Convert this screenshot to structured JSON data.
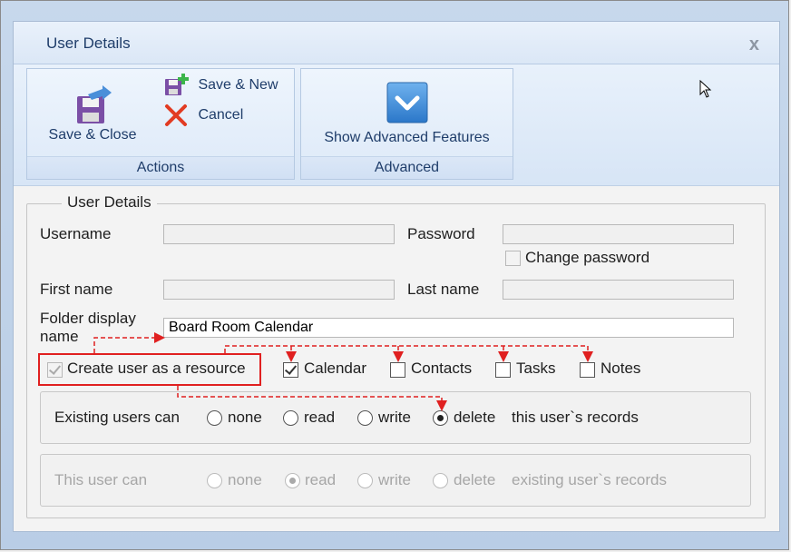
{
  "window": {
    "title": "User Details",
    "close_glyph": "x"
  },
  "ribbon": {
    "actions": {
      "group_label": "Actions",
      "save_close_label": "Save & Close",
      "save_new_label": "Save & New",
      "cancel_label": "Cancel"
    },
    "advanced": {
      "group_label": "Advanced",
      "show_advanced_label": "Show Advanced Features"
    }
  },
  "form": {
    "legend": "User Details",
    "username_label": "Username",
    "username_value": "",
    "password_label": "Password",
    "password_value": "",
    "change_password_label": "Change password",
    "change_password_checked": false,
    "first_name_label": "First name",
    "first_name_value": "",
    "last_name_label": "Last name",
    "last_name_value": "",
    "folder_display_name_label_line1": "Folder display",
    "folder_display_name_label_line2": "name",
    "folder_display_name_value": "Board Room Calendar",
    "create_resource_label": "Create user as a resource",
    "create_resource_checked": true,
    "folders": [
      {
        "label": "Calendar",
        "checked": true
      },
      {
        "label": "Contacts",
        "checked": false
      },
      {
        "label": "Tasks",
        "checked": false
      },
      {
        "label": "Notes",
        "checked": false
      }
    ],
    "existing_users": {
      "label": "Existing users can",
      "options": [
        "none",
        "read",
        "write",
        "delete"
      ],
      "selected": "delete",
      "suffix": "this user`s records"
    },
    "this_user": {
      "label": "This user can",
      "options": [
        "none",
        "read",
        "write",
        "delete"
      ],
      "selected": "read",
      "suffix": "existing user`s records"
    }
  },
  "colors": {
    "accent": "#1f3d6a",
    "highlight_red": "#e02020",
    "ribbon_bg": "#dde9f8"
  }
}
